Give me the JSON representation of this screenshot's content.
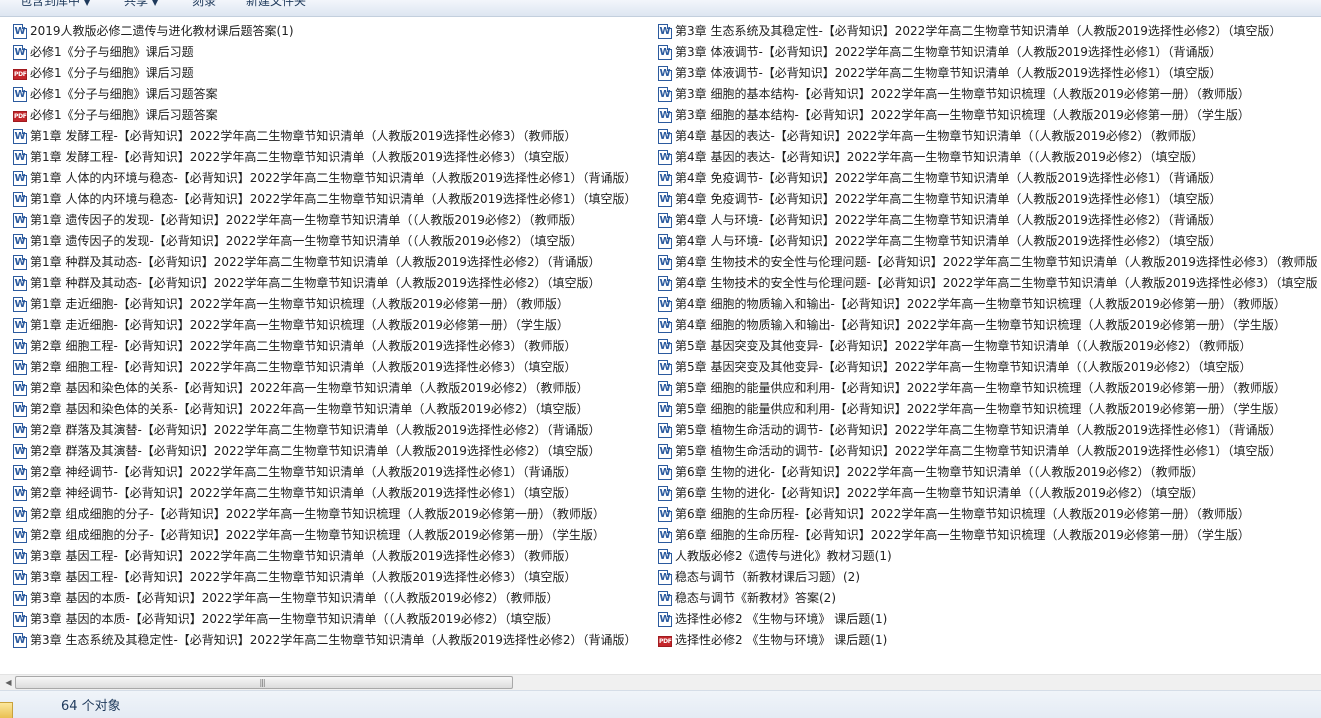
{
  "toolbar": {
    "include_in_library": "包含到库中",
    "share": "共享",
    "burn": "刻录",
    "new_folder": "新建文件夹"
  },
  "files_left": [
    {
      "type": "word",
      "name": "2019人教版必修二遗传与进化教材课后题答案(1)"
    },
    {
      "type": "word",
      "name": "必修1《分子与细胞》课后习题"
    },
    {
      "type": "pdf",
      "name": "必修1《分子与细胞》课后习题"
    },
    {
      "type": "word",
      "name": "必修1《分子与细胞》课后习题答案"
    },
    {
      "type": "pdf",
      "name": "必修1《分子与细胞》课后习题答案"
    },
    {
      "type": "word",
      "name": "第1章 发酵工程-【必背知识】2022学年高二生物章节知识清单（人教版2019选择性必修3）（教师版）"
    },
    {
      "type": "word",
      "name": "第1章 发酵工程-【必背知识】2022学年高二生物章节知识清单（人教版2019选择性必修3）（填空版）"
    },
    {
      "type": "word",
      "name": "第1章 人体的内环境与稳态-【必背知识】2022学年高二生物章节知识清单（人教版2019选择性必修1）（背诵版）"
    },
    {
      "type": "word",
      "name": "第1章 人体的内环境与稳态-【必背知识】2022学年高二生物章节知识清单（人教版2019选择性必修1）（填空版）"
    },
    {
      "type": "word",
      "name": "第1章 遗传因子的发现-【必背知识】2022学年高一生物章节知识清单（（人教版2019必修2）（教师版）"
    },
    {
      "type": "word",
      "name": "第1章 遗传因子的发现-【必背知识】2022学年高一生物章节知识清单（（人教版2019必修2）（填空版）"
    },
    {
      "type": "word",
      "name": "第1章 种群及其动态-【必背知识】2022学年高二生物章节知识清单（人教版2019选择性必修2）（背诵版）"
    },
    {
      "type": "word",
      "name": "第1章 种群及其动态-【必背知识】2022学年高二生物章节知识清单（人教版2019选择性必修2）（填空版）"
    },
    {
      "type": "word",
      "name": "第1章 走近细胞-【必背知识】2022学年高一生物章节知识梳理（人教版2019必修第一册）（教师版）"
    },
    {
      "type": "word",
      "name": "第1章 走近细胞-【必背知识】2022学年高一生物章节知识梳理（人教版2019必修第一册）（学生版）"
    },
    {
      "type": "word",
      "name": "第2章  细胞工程-【必背知识】2022学年高二生物章节知识清单（人教版2019选择性必修3）（教师版）"
    },
    {
      "type": "word",
      "name": "第2章  细胞工程-【必背知识】2022学年高二生物章节知识清单（人教版2019选择性必修3）（填空版）"
    },
    {
      "type": "word",
      "name": "第2章 基因和染色体的关系-【必背知识】2022年高一生物章节知识清单（人教版2019必修2）（教师版）"
    },
    {
      "type": "word",
      "name": "第2章 基因和染色体的关系-【必背知识】2022年高一生物章节知识清单（人教版2019必修2）（填空版）"
    },
    {
      "type": "word",
      "name": "第2章 群落及其演替-【必背知识】2022学年高二生物章节知识清单（人教版2019选择性必修2）（背诵版）"
    },
    {
      "type": "word",
      "name": "第2章 群落及其演替-【必背知识】2022学年高二生物章节知识清单（人教版2019选择性必修2）（填空版）"
    },
    {
      "type": "word",
      "name": "第2章 神经调节-【必背知识】2022学年高二生物章节知识清单（人教版2019选择性必修1）（背诵版）"
    },
    {
      "type": "word",
      "name": "第2章 神经调节-【必背知识】2022学年高二生物章节知识清单（人教版2019选择性必修1）（填空版）"
    },
    {
      "type": "word",
      "name": "第2章 组成细胞的分子-【必背知识】2022学年高一生物章节知识梳理（人教版2019必修第一册）（教师版）"
    },
    {
      "type": "word",
      "name": "第2章 组成细胞的分子-【必背知识】2022学年高一生物章节知识梳理（人教版2019必修第一册）（学生版）"
    },
    {
      "type": "word",
      "name": "第3章  基因工程-【必背知识】2022学年高二生物章节知识清单（人教版2019选择性必修3）（教师版）"
    },
    {
      "type": "word",
      "name": "第3章  基因工程-【必背知识】2022学年高二生物章节知识清单（人教版2019选择性必修3）（填空版）"
    },
    {
      "type": "word",
      "name": "第3章 基因的本质-【必背知识】2022学年高一生物章节知识清单（（人教版2019必修2）（教师版）"
    },
    {
      "type": "word",
      "name": "第3章 基因的本质-【必背知识】2022学年高一生物章节知识清单（（人教版2019必修2）（填空版）"
    },
    {
      "type": "word",
      "name": "第3章 生态系统及其稳定性-【必背知识】2022学年高二生物章节知识清单（人教版2019选择性必修2）（背诵版）"
    }
  ],
  "files_right": [
    {
      "type": "word",
      "name": "第3章 生态系统及其稳定性-【必背知识】2022学年高二生物章节知识清单（人教版2019选择性必修2）（填空版）"
    },
    {
      "type": "word",
      "name": "第3章 体液调节-【必背知识】2022学年高二生物章节知识清单（人教版2019选择性必修1）（背诵版）"
    },
    {
      "type": "word",
      "name": "第3章 体液调节-【必背知识】2022学年高二生物章节知识清单（人教版2019选择性必修1）（填空版）"
    },
    {
      "type": "word",
      "name": "第3章 细胞的基本结构-【必背知识】2022学年高一生物章节知识梳理（人教版2019必修第一册）（教师版）"
    },
    {
      "type": "word",
      "name": "第3章 细胞的基本结构-【必背知识】2022学年高一生物章节知识梳理（人教版2019必修第一册）（学生版）"
    },
    {
      "type": "word",
      "name": "第4章 基因的表达-【必背知识】2022学年高一生物章节知识清单（（人教版2019必修2）（教师版）"
    },
    {
      "type": "word",
      "name": "第4章 基因的表达-【必背知识】2022学年高一生物章节知识清单（（人教版2019必修2）（填空版）"
    },
    {
      "type": "word",
      "name": "第4章 免疫调节-【必背知识】2022学年高二生物章节知识清单（人教版2019选择性必修1）（背诵版）"
    },
    {
      "type": "word",
      "name": "第4章 免疫调节-【必背知识】2022学年高二生物章节知识清单（人教版2019选择性必修1）（填空版）"
    },
    {
      "type": "word",
      "name": "第4章 人与环境-【必背知识】2022学年高二生物章节知识清单（人教版2019选择性必修2）（背诵版）"
    },
    {
      "type": "word",
      "name": "第4章 人与环境-【必背知识】2022学年高二生物章节知识清单（人教版2019选择性必修2）（填空版）"
    },
    {
      "type": "word",
      "name": "第4章 生物技术的安全性与伦理问题-【必背知识】2022学年高二生物章节知识清单（人教版2019选择性必修3）（教师版"
    },
    {
      "type": "word",
      "name": "第4章 生物技术的安全性与伦理问题-【必背知识】2022学年高二生物章节知识清单（人教版2019选择性必修3）（填空版"
    },
    {
      "type": "word",
      "name": "第4章 细胞的物质输入和输出-【必背知识】2022学年高一生物章节知识梳理（人教版2019必修第一册）（教师版）"
    },
    {
      "type": "word",
      "name": "第4章 细胞的物质输入和输出-【必背知识】2022学年高一生物章节知识梳理（人教版2019必修第一册）（学生版）"
    },
    {
      "type": "word",
      "name": "第5章 基因突变及其他变异-【必背知识】2022学年高一生物章节知识清单（（人教版2019必修2）（教师版）"
    },
    {
      "type": "word",
      "name": "第5章 基因突变及其他变异-【必背知识】2022学年高一生物章节知识清单（（人教版2019必修2）（填空版）"
    },
    {
      "type": "word",
      "name": "第5章 细胞的能量供应和利用-【必背知识】2022学年高一生物章节知识梳理（人教版2019必修第一册）（教师版）"
    },
    {
      "type": "word",
      "name": "第5章 细胞的能量供应和利用-【必背知识】2022学年高一生物章节知识梳理（人教版2019必修第一册）（学生版）"
    },
    {
      "type": "word",
      "name": "第5章 植物生命活动的调节-【必背知识】2022学年高二生物章节知识清单（人教版2019选择性必修1）（背诵版）"
    },
    {
      "type": "word",
      "name": "第5章 植物生命活动的调节-【必背知识】2022学年高二生物章节知识清单（人教版2019选择性必修1）（填空版）"
    },
    {
      "type": "word",
      "name": "第6章 生物的进化-【必背知识】2022学年高一生物章节知识清单（（人教版2019必修2）（教师版）"
    },
    {
      "type": "word",
      "name": "第6章 生物的进化-【必背知识】2022学年高一生物章节知识清单（（人教版2019必修2）（填空版）"
    },
    {
      "type": "word",
      "name": "第6章 细胞的生命历程-【必背知识】2022学年高一生物章节知识梳理（人教版2019必修第一册）（教师版）"
    },
    {
      "type": "word",
      "name": "第6章 细胞的生命历程-【必背知识】2022学年高一生物章节知识梳理（人教版2019必修第一册）（学生版）"
    },
    {
      "type": "word",
      "name": "人教版必修2《遗传与进化》教材习题(1)"
    },
    {
      "type": "word",
      "name": "稳态与调节（新教材课后习题）(2)"
    },
    {
      "type": "word",
      "name": "稳态与调节《新教材》答案(2)"
    },
    {
      "type": "word",
      "name": "选择性必修2 《生物与环境》 课后题(1)"
    },
    {
      "type": "pdf",
      "name": "选择性必修2 《生物与环境》 课后题(1)"
    }
  ],
  "status": {
    "object_count": "64 个对象"
  },
  "icons": {
    "word": "word-doc-icon",
    "pdf": "pdf-doc-icon"
  }
}
